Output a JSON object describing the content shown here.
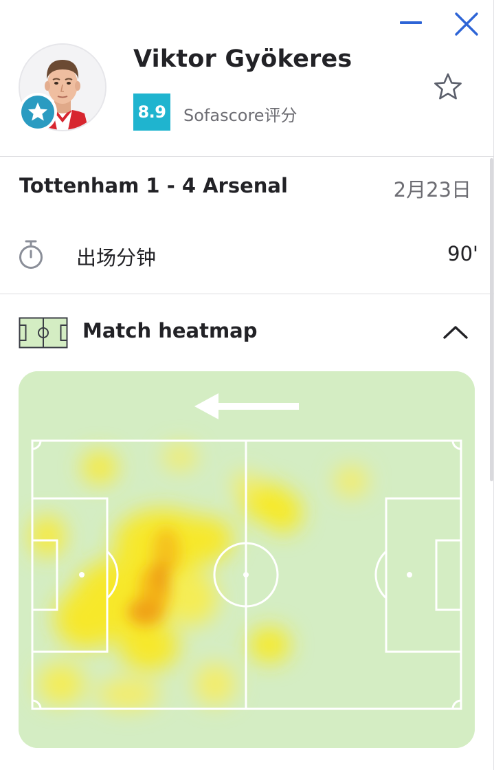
{
  "window": {
    "minimize_icon": "minimize-icon",
    "close_icon": "close-icon",
    "accent_color": "#2d64d6"
  },
  "player": {
    "name": "Viktor Gyökeres",
    "rating": "8.9",
    "rating_label": "Sofascore评分",
    "rating_color": "#1fb4cf",
    "badge_icon": "star-icon",
    "favorite_icon": "star-outline-icon"
  },
  "match": {
    "title": "Tottenham 1 - 4 Arsenal",
    "date": "2月23日"
  },
  "minutes": {
    "icon": "stopwatch-icon",
    "label": "出场分钟",
    "value": "90'"
  },
  "heatmap": {
    "icon": "pitch-icon",
    "title": "Match heatmap",
    "toggle_icon": "chevron-up-icon",
    "attack_direction": "left"
  }
}
